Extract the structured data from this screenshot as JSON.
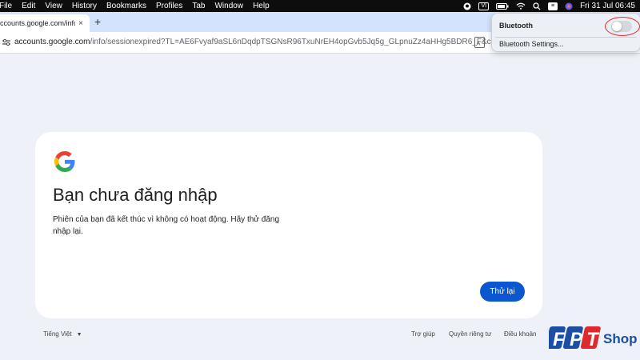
{
  "menubar": {
    "items": [
      "File",
      "Edit",
      "View",
      "History",
      "Bookmarks",
      "Profiles",
      "Tab",
      "Window",
      "Help"
    ],
    "input_source": "VI",
    "datetime": "Fri 31 Jul  06:45"
  },
  "browser": {
    "tab_title": "ccounts.google.com/info/se",
    "tab_close": "×",
    "new_tab": "+",
    "url_host": "accounts.google.com",
    "url_rest": "/info/sessionexpired?TL=AE6Fvyaf9aSL6nDqdpTSGNsR96TxuNrEH4opGvb5Jq5g_GLpnuZz4aHHg5BDR6_F&checkC..."
  },
  "bluetooth_menu": {
    "title": "Bluetooth",
    "toggle_on": false,
    "settings_label": "Bluetooth Settings..."
  },
  "card": {
    "title": "Bạn chưa đăng nhập",
    "description": "Phiên của bạn đã kết thúc vì không có hoạt động. Hãy thử đăng nhập lại.",
    "retry_label": "Thử lại"
  },
  "footer": {
    "language": "Tiếng Việt",
    "help": "Trợ giúp",
    "privacy": "Quyền riêng tư",
    "terms": "Điều khoản"
  },
  "watermark": {
    "brand": "FPT Shop"
  },
  "colors": {
    "primary_button": "#0b57d0",
    "page_background": "#eef1f8",
    "tabstrip": "#d3e3fd",
    "highlight_ring": "#e0292d"
  }
}
